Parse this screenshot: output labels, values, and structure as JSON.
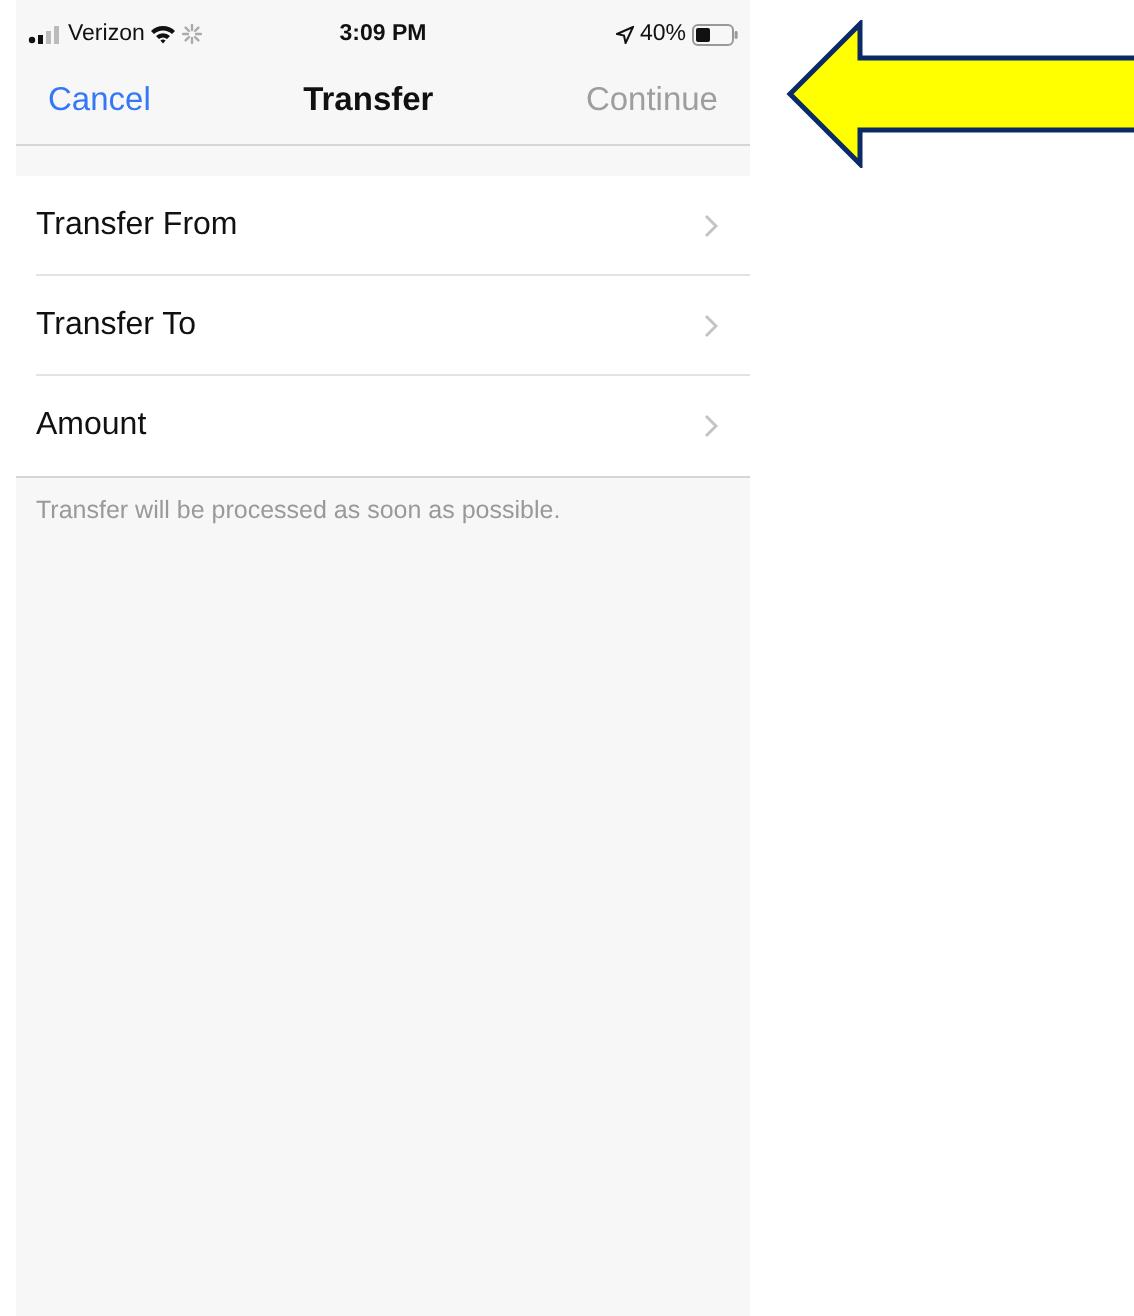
{
  "status_bar": {
    "carrier": "Verizon",
    "time": "3:09 PM",
    "battery": "40%"
  },
  "nav_bar": {
    "cancel": "Cancel",
    "title": "Transfer",
    "continue": {
      "label": "Continue",
      "disabled": true
    }
  },
  "rows": [
    {
      "label": "Transfer From"
    },
    {
      "label": "Transfer To"
    },
    {
      "label": "Amount"
    }
  ],
  "footer_note": "Transfer will be processed as soon as possible."
}
